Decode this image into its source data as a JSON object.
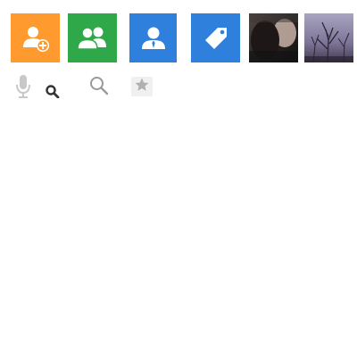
{
  "tiles": [
    {
      "icon": "add-contact-icon",
      "color": "#ff9a2e"
    },
    {
      "icon": "group-icon",
      "color": "#2fa84a"
    },
    {
      "icon": "person-icon",
      "color": "#2f80dc"
    },
    {
      "icon": "tag-icon",
      "color": "#2f80dc"
    }
  ],
  "photos": [
    {
      "icon": "photo-thumbnail-icon"
    },
    {
      "icon": "photo-thumbnail-icon"
    }
  ],
  "toolbar": [
    {
      "icon": "microphone-icon",
      "color": "#c8c8c8"
    },
    {
      "icon": "zoom-search-icon",
      "color": "#333333"
    },
    {
      "icon": "search-icon",
      "color": "#9a9a9a"
    },
    {
      "icon": "star-icon",
      "color": "#b0b0b0"
    }
  ]
}
